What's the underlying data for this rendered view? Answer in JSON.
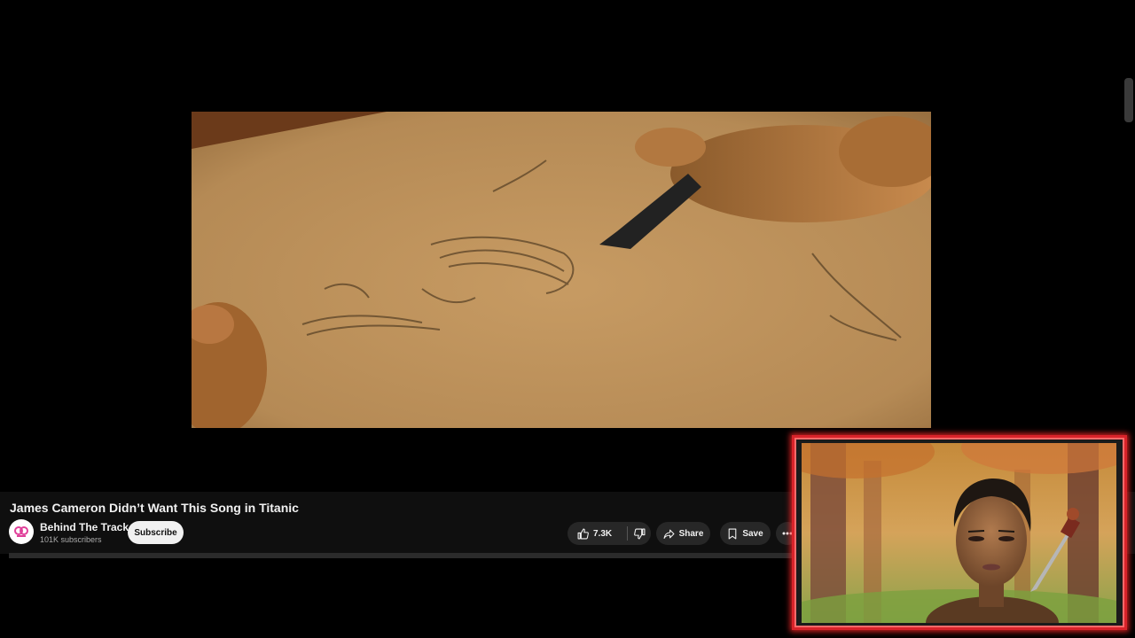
{
  "video": {
    "title": "James Cameron Didn’t Want This Song in Titanic"
  },
  "channel": {
    "name": "Behind The Track",
    "subscribers": "101K subscribers",
    "avatar_icon": "channel-logo-icon"
  },
  "actions": {
    "subscribe_label": "Subscribe",
    "like_count": "7.3K",
    "share_label": "Share",
    "save_label": "Save"
  },
  "icons": {
    "like": "thumbs-up-icon",
    "dislike": "thumbs-down-icon",
    "share": "share-arrow-icon",
    "save": "bookmark-icon",
    "more": "more-horizontal-icon"
  },
  "colors": {
    "background": "#000000",
    "panel": "#0f0f0f",
    "pill": "#272727",
    "subscribe_bg": "#f1f1f1",
    "webcam_border": "#d8232a",
    "avatar_accent": "#e0409a"
  }
}
